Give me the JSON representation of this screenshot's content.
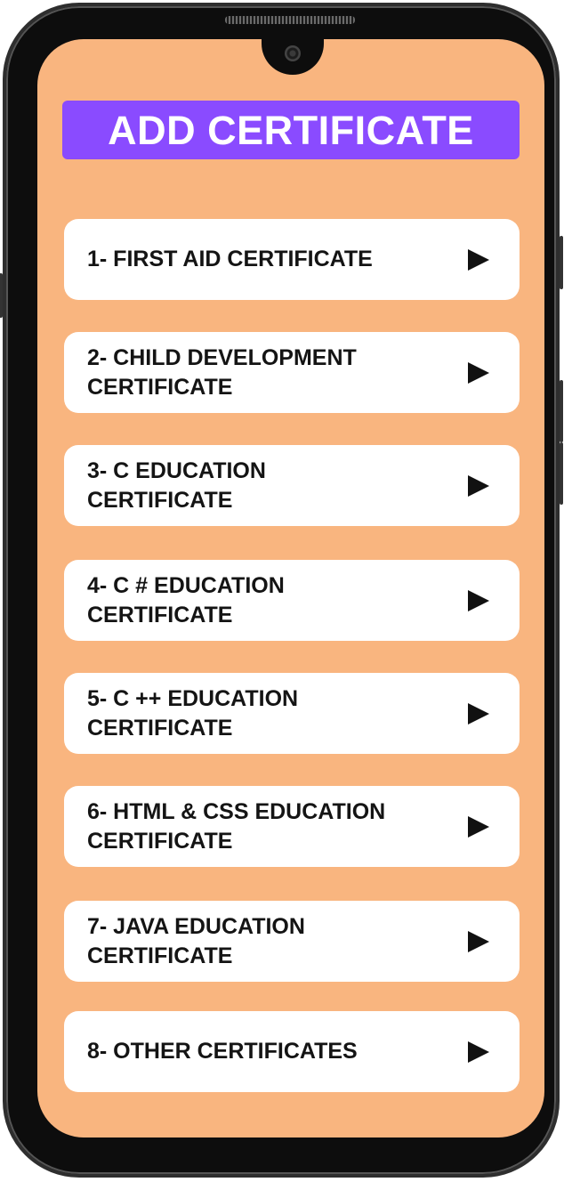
{
  "header": {
    "title": "ADD CERTIFICATE"
  },
  "certificates": [
    {
      "label": "1- FIRST AID CERTIFICATE",
      "icon": "play-arrow-icon"
    },
    {
      "label": "2- CHILD DEVELOPMENT\nCERTIFICATE",
      "icon": "play-arrow-icon"
    },
    {
      "label": "3- C EDUCATION\nCERTIFICATE",
      "icon": "play-arrow-icon"
    },
    {
      "label": "4- C # EDUCATION\nCERTIFICATE",
      "icon": "play-arrow-icon"
    },
    {
      "label": "5- C ++ EDUCATION\nCERTIFICATE",
      "icon": "play-arrow-icon"
    },
    {
      "label": "6- HTML & CSS EDUCATION\nCERTIFICATE",
      "icon": "play-arrow-icon"
    },
    {
      "label": "7- JAVA EDUCATION\nCERTIFICATE",
      "icon": "play-arrow-icon"
    },
    {
      "label": "8- OTHER CERTIFICATES",
      "icon": "play-arrow-icon"
    }
  ],
  "colors": {
    "screen_background": "#f9b57f",
    "header_background": "#8a4bff",
    "header_text": "#ffffff",
    "item_background": "#ffffff",
    "item_text": "#141414"
  }
}
